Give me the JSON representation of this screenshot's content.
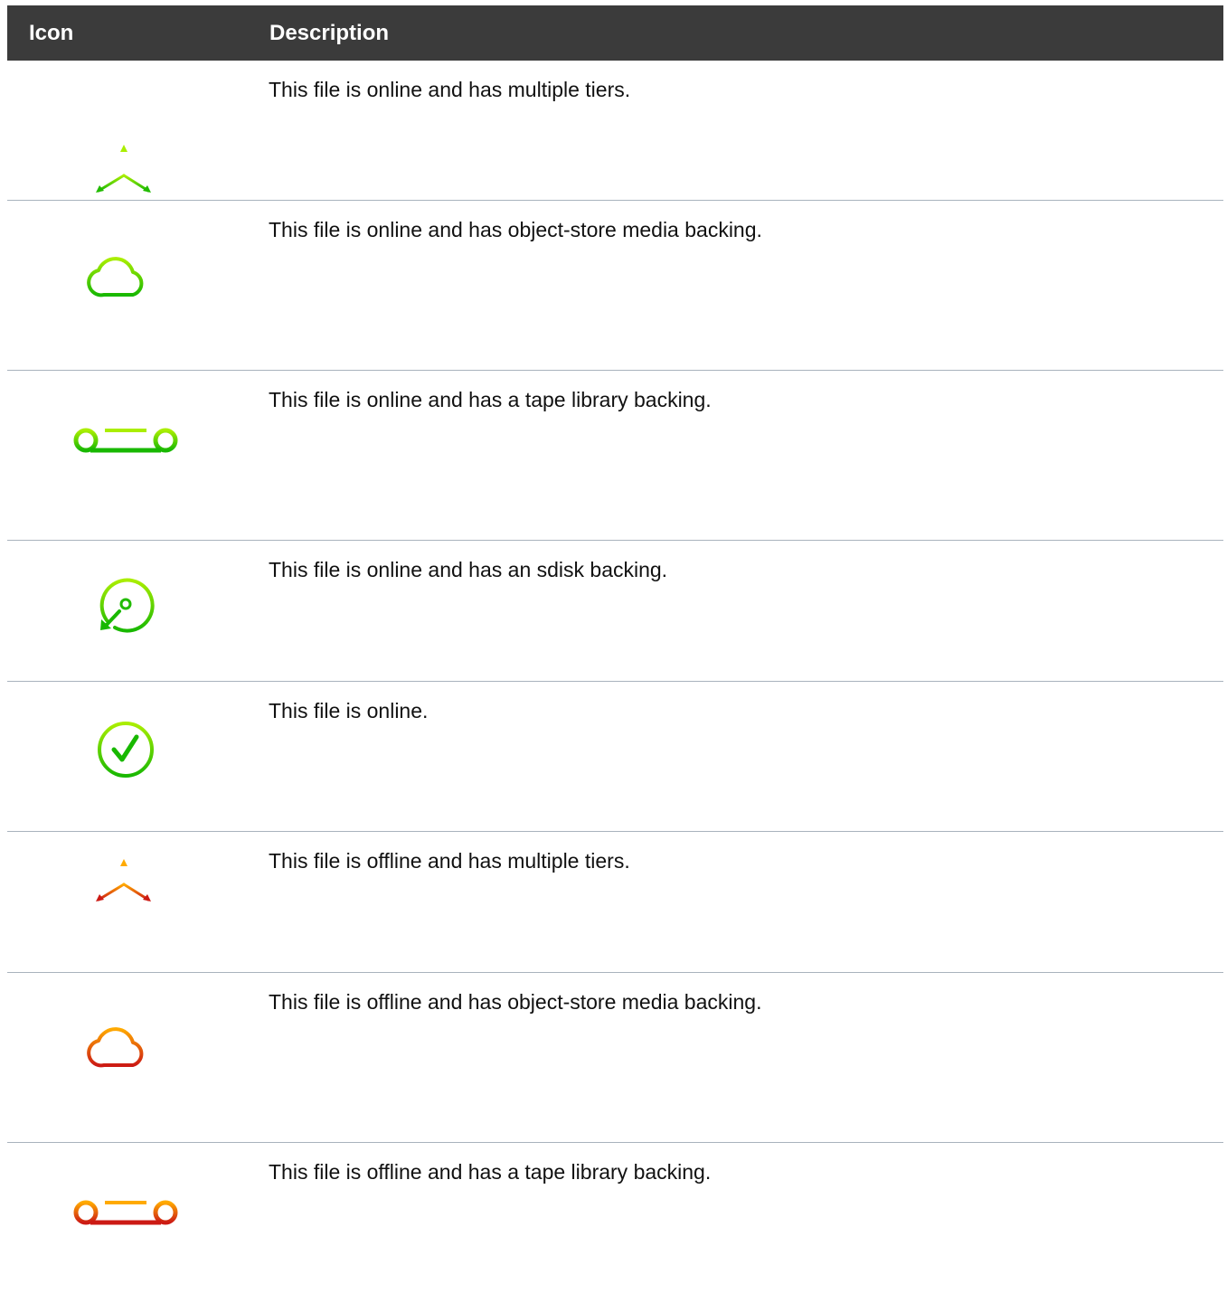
{
  "table": {
    "headers": {
      "icon": "Icon",
      "description": "Description"
    },
    "rows": [
      {
        "icon": "multi-tier-online-icon",
        "status_color": "#22bb00",
        "description": "This file is online and has multiple tiers."
      },
      {
        "icon": "cloud-online-icon",
        "status_color": "#22bb00",
        "description": "This file is online and has object-store media backing."
      },
      {
        "icon": "tape-online-icon",
        "status_color": "#22bb00",
        "description": "This file is online and has a tape library backing."
      },
      {
        "icon": "sdisk-online-icon",
        "status_color": "#22bb00",
        "description": "This file is online and has an sdisk backing."
      },
      {
        "icon": "check-online-icon",
        "status_color": "#22bb00",
        "description": "This file is online."
      },
      {
        "icon": "multi-tier-offline-icon",
        "status_color": "#d42a1a",
        "description": "This file is offline and has multiple tiers."
      },
      {
        "icon": "cloud-offline-icon",
        "status_color": "#d42a1a",
        "description": "This file is offline and has object-store media backing."
      },
      {
        "icon": "tape-offline-icon",
        "status_color": "#d42a1a",
        "description": "This file is offline and has a tape library backing."
      }
    ]
  },
  "colors": {
    "header_bg": "#3b3b3b",
    "header_text": "#ffffff",
    "divider": "#a9b3bd",
    "online_green": "#22bb00",
    "online_light": "#99ee00",
    "offline_red": "#d42a1a",
    "offline_orange": "#ffaa00"
  }
}
